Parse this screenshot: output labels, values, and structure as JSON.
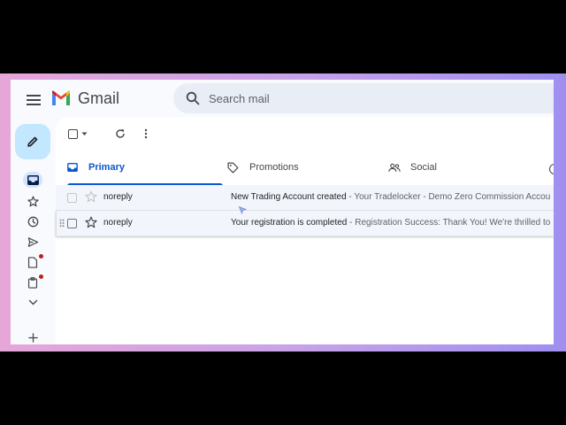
{
  "app": {
    "brand": "Gmail",
    "accent": "#0b57d0",
    "compose_color": "#c2e7ff",
    "badge_color": "#b3261e"
  },
  "header": {
    "menu_icon": "hamburger-menu-icon",
    "logo_icon": "gmail-m-logo-icon",
    "search": {
      "icon": "search-icon",
      "placeholder": "Search mail"
    }
  },
  "sidebar": {
    "compose_icon": "pencil-icon",
    "items": [
      {
        "icon": "inbox-icon",
        "active": true
      },
      {
        "icon": "star-icon"
      },
      {
        "icon": "clock-icon"
      },
      {
        "icon": "send-icon"
      },
      {
        "icon": "draft-icon",
        "badge": true
      },
      {
        "icon": "clipboard-icon",
        "badge": true
      },
      {
        "icon": "chevron-down-icon"
      },
      {
        "icon": "plus-icon"
      }
    ]
  },
  "toolbar": {
    "icons": [
      "select-checkbox-icon",
      "caret-down-icon",
      "refresh-icon",
      "more-vertical-icon"
    ]
  },
  "tabs": [
    {
      "label": "Primary",
      "icon": "inbox-icon",
      "active": true
    },
    {
      "label": "Promotions",
      "icon": "tag-icon"
    },
    {
      "label": "Social",
      "icon": "people-icon"
    }
  ],
  "emails": [
    {
      "sender": "noreply",
      "subject": "New Trading Account created",
      "snippet": " - Your Tradelocker - Demo Zero Commission Accou",
      "starred": false
    },
    {
      "sender": "noreply",
      "subject": "Your registration is completed",
      "snippet": " - Registration Success: Thank You! We're thrilled to",
      "starred": false
    }
  ]
}
